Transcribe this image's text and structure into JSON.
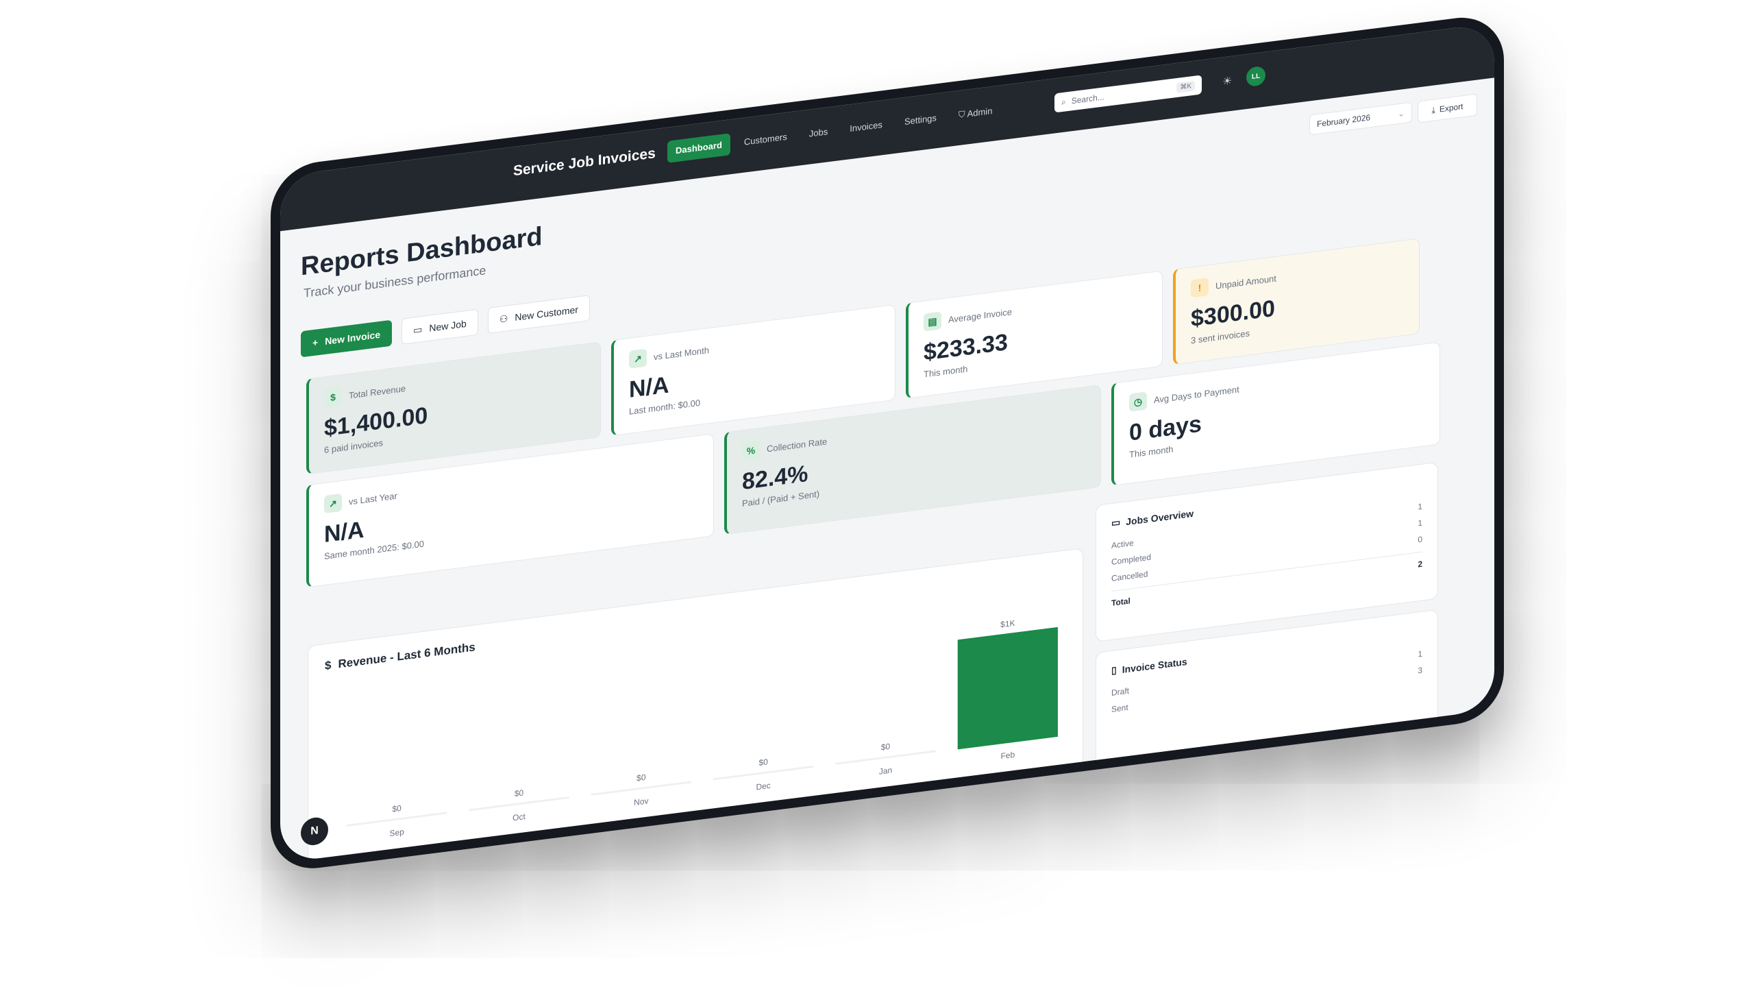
{
  "app": {
    "title": "Service Job Invoices"
  },
  "nav": {
    "items": [
      "Dashboard",
      "Customers",
      "Jobs",
      "Invoices",
      "Settings",
      "Admin"
    ],
    "active": "Dashboard"
  },
  "search": {
    "placeholder": "Search...",
    "shortcut": "⌘K"
  },
  "user": {
    "initials": "LL"
  },
  "header": {
    "title": "Reports Dashboard",
    "subtitle": "Track your business performance",
    "month": "February 2026",
    "export_label": "Export"
  },
  "actions": {
    "new_invoice": "New Invoice",
    "new_job": "New Job",
    "new_customer": "New Customer"
  },
  "stats": {
    "total_revenue": {
      "label": "Total Revenue",
      "value": "$1,400.00",
      "sub": "6 paid invoices"
    },
    "vs_last_month": {
      "label": "vs Last Month",
      "value": "N/A",
      "sub": "Last month: $0.00"
    },
    "average_invoice": {
      "label": "Average Invoice",
      "value": "$233.33",
      "sub": "This month"
    },
    "unpaid_amount": {
      "label": "Unpaid Amount",
      "value": "$300.00",
      "sub": "3 sent invoices"
    },
    "vs_last_year": {
      "label": "vs Last Year",
      "value": "N/A",
      "sub": "Same month 2025: $0.00"
    },
    "collection_rate": {
      "label": "Collection Rate",
      "value": "82.4%",
      "sub": "Paid / (Paid + Sent)"
    },
    "avg_days": {
      "label": "Avg Days to Payment",
      "value": "0 days",
      "sub": "This month"
    }
  },
  "jobs_overview": {
    "title": "Jobs Overview",
    "rows": [
      {
        "label": "Active",
        "value": "1"
      },
      {
        "label": "Completed",
        "value": "1"
      },
      {
        "label": "Cancelled",
        "value": "0"
      }
    ],
    "total_label": "Total",
    "total_value": "2"
  },
  "invoice_status": {
    "title": "Invoice Status",
    "rows": [
      {
        "label": "Draft",
        "value": "1"
      },
      {
        "label": "Sent",
        "value": "3"
      }
    ]
  },
  "colors": {
    "accent": "#1b8a4a",
    "warning": "#f0a21c",
    "nav_bg": "#23272e"
  },
  "chart_data": {
    "type": "bar",
    "title": "Revenue - Last 6 Months",
    "categories": [
      "Sep",
      "Oct",
      "Nov",
      "Dec",
      "Jan",
      "Feb"
    ],
    "values": [
      0,
      0,
      0,
      0,
      0,
      1000
    ],
    "value_labels": [
      "$0",
      "$0",
      "$0",
      "$0",
      "$0",
      "$1K"
    ],
    "xlabel": "",
    "ylabel": "",
    "grid": false
  }
}
